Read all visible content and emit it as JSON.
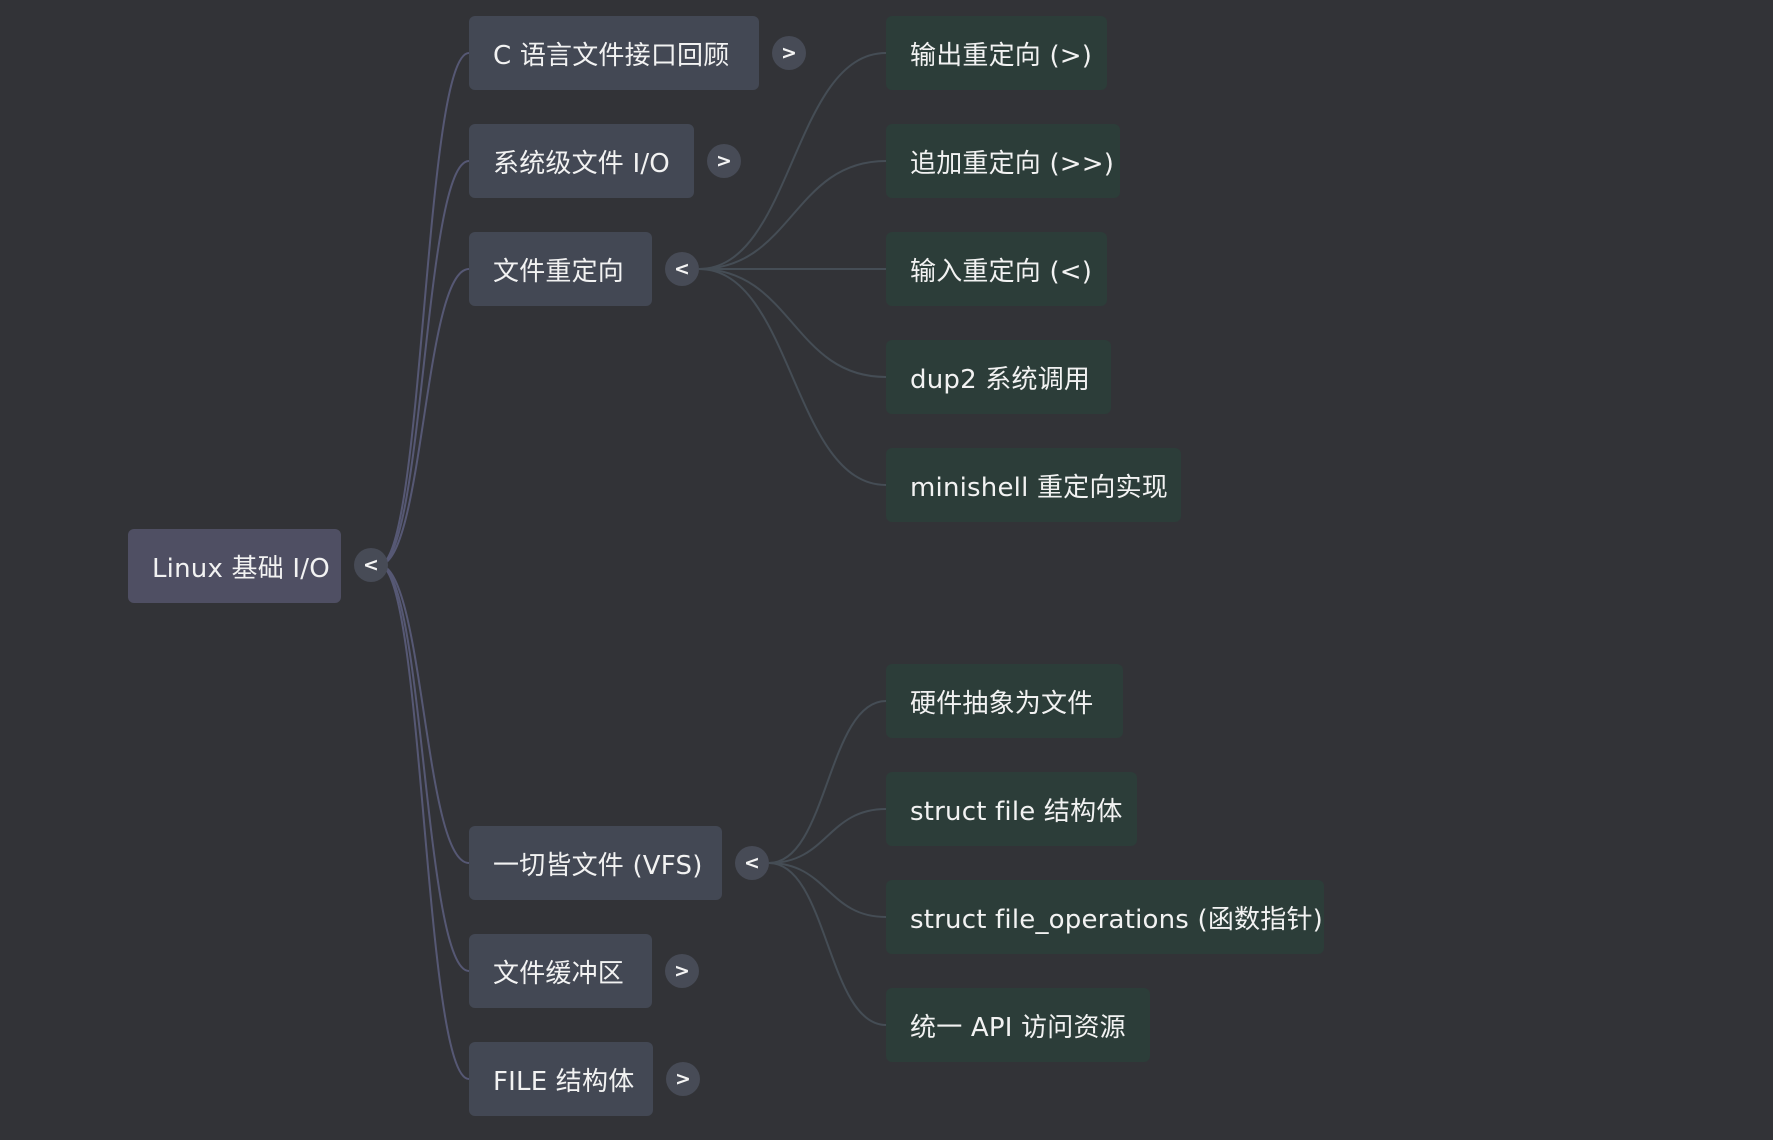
{
  "colors": {
    "background": "#323337",
    "root_node": "#4f4f63",
    "branch_node": "#434854",
    "leaf_node": "#2c3d39",
    "root_link": "#565874",
    "leaf_link": "#454d55"
  },
  "root": {
    "label": "Linux 基础 I/O",
    "toggle": "<"
  },
  "branches": [
    {
      "label": "C 语言文件接口回顾",
      "toggle": ">",
      "expanded": false,
      "children": []
    },
    {
      "label": "系统级文件 I/O",
      "toggle": ">",
      "expanded": false,
      "children": []
    },
    {
      "label": "文件重定向",
      "toggle": "<",
      "expanded": true,
      "children": [
        "输出重定向 (>)",
        "追加重定向 (>>)",
        "输入重定向 (<)",
        "dup2 系统调用",
        "minishell 重定向实现"
      ]
    },
    {
      "label": "一切皆文件 (VFS)",
      "toggle": "<",
      "expanded": true,
      "children": [
        "硬件抽象为文件",
        "struct file 结构体",
        "struct file_operations (函数指针)",
        "统一 API 访问资源"
      ]
    },
    {
      "label": "文件缓冲区",
      "toggle": ">",
      "expanded": false,
      "children": []
    },
    {
      "label": "FILE 结构体",
      "toggle": ">",
      "expanded": false,
      "children": []
    }
  ]
}
